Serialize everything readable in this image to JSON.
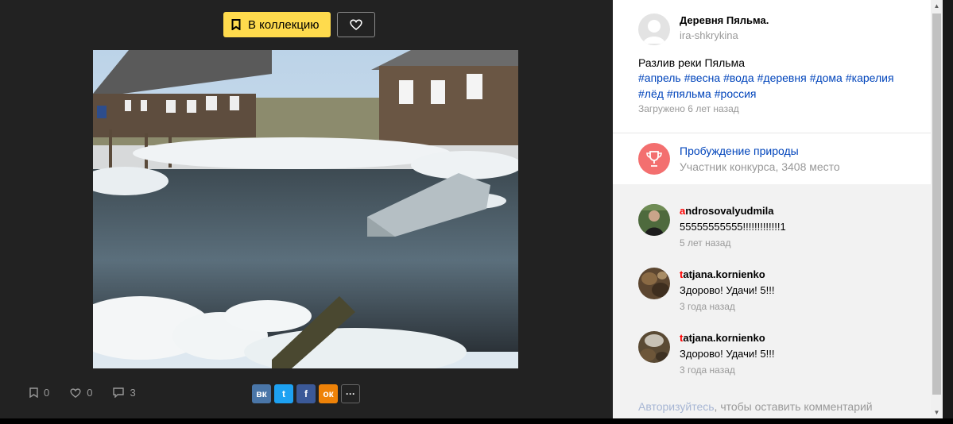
{
  "viewer": {
    "collect_label": "В коллекцию",
    "photo_alt": "Разлив реки Пяльма",
    "stats": {
      "saves": "0",
      "likes": "0",
      "comments": "3"
    },
    "share": [
      {
        "name": "vk",
        "glyph": "вк",
        "color": "#4a76a8"
      },
      {
        "name": "twitter",
        "glyph": "t",
        "color": "#1da1f2"
      },
      {
        "name": "facebook",
        "glyph": "f",
        "color": "#3b5998"
      },
      {
        "name": "odnoklassniki",
        "glyph": "ок",
        "color": "#ee8208"
      }
    ],
    "more_label": "···"
  },
  "author": {
    "name": "Деревня Пяльма.",
    "login": "ira-shkrykina"
  },
  "photo": {
    "description": "Разлив реки Пяльма",
    "tags": [
      "#апрель",
      "#весна",
      "#вода",
      "#деревня",
      "#дома",
      "#карелия",
      "#лёд",
      "#пяльма",
      "#россия"
    ],
    "uploaded": "Загружено 6 лет назад"
  },
  "contest": {
    "title": "Пробуждение природы",
    "subtitle": "Участник конкурса, 3408 место",
    "icon": "trophy-icon",
    "color": "#f36f6f"
  },
  "comments": [
    {
      "user_first": "a",
      "user_rest": "ndrosovalyudmila",
      "text": "55555555555!!!!!!!!!!!!!1",
      "time": "5 лет назад"
    },
    {
      "user_first": "t",
      "user_rest": "atjana.kornienko",
      "text": "Здорово! Удачи! 5!!!",
      "time": "3 года назад"
    },
    {
      "user_first": "t",
      "user_rest": "atjana.kornienko",
      "text": "Здорово! Удачи! 5!!!",
      "time": "3 года назад"
    }
  ],
  "login_note": {
    "link": "Авторизуйтесь",
    "rest": ", чтобы оставить комментарий"
  }
}
